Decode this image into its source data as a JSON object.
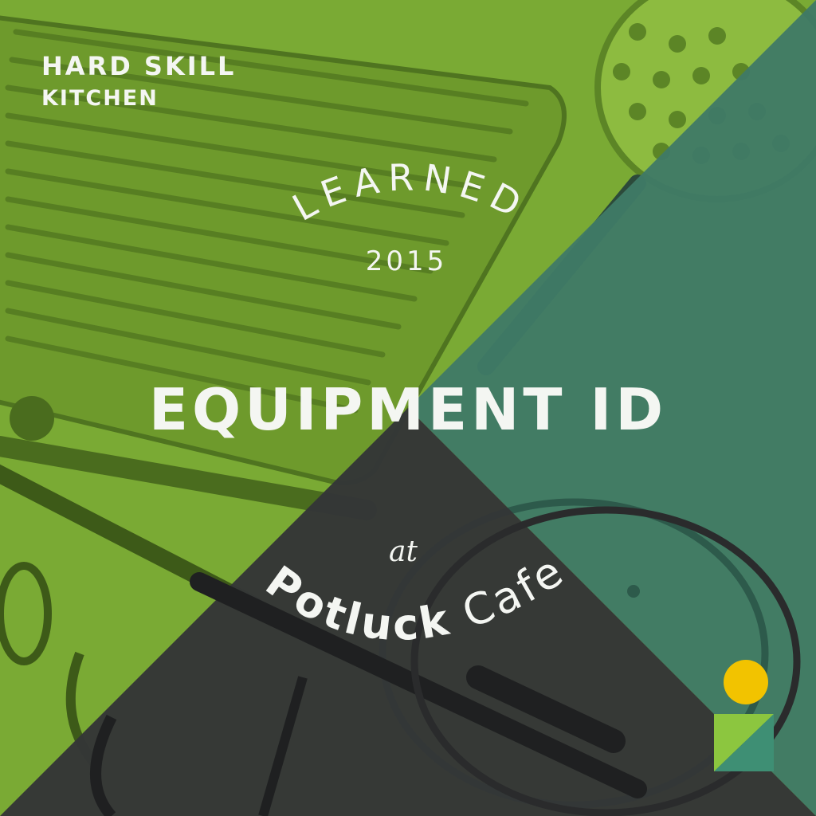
{
  "badge": {
    "brand_line1": "HARD SKILL",
    "brand_line2": "KITCHEN",
    "learned": "LEARNED",
    "year": "2015",
    "title": "EQUIPMENT ID",
    "at": "at",
    "venue_bold": "Potluck",
    "venue_light": "Cafe"
  },
  "colors": {
    "green": "#7aaa34",
    "teal": "#3f7a66",
    "charcoal": "#343637",
    "logo_yellow": "#f2c300",
    "logo_green": "#8cc63f",
    "logo_teal": "#3e8f74"
  },
  "icons": [
    "frying-pan-illustration",
    "skimmer-illustration",
    "lid-illustration",
    "utensil-illustration",
    "logo-mark-icon"
  ]
}
